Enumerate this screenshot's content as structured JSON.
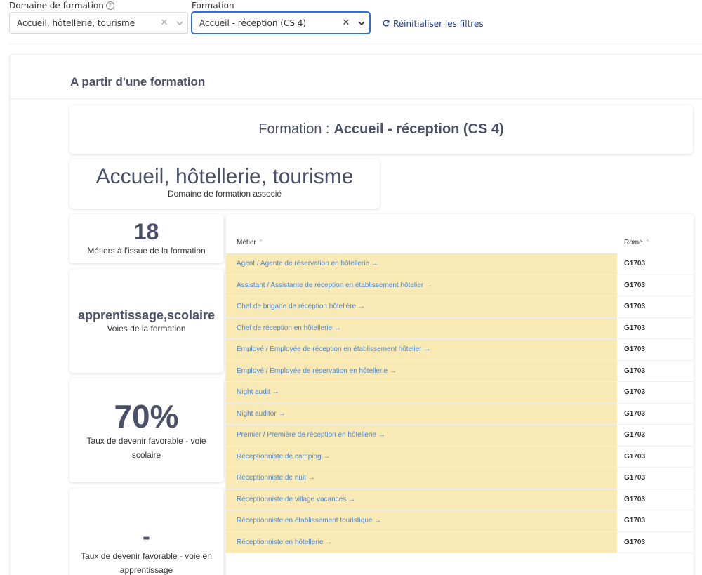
{
  "filters": {
    "domaine": {
      "label": "Domaine de formation",
      "value": "Accueil, hôtellerie, tourisme"
    },
    "formation": {
      "label": "Formation",
      "value": "Accueil - réception (CS 4)"
    },
    "reset_label": "Réinitialiser les filtres"
  },
  "section_title": "A partir d'une formation",
  "formation_card": {
    "prefix": "Formation :",
    "name": "Accueil - réception (CS 4)"
  },
  "domaine_card": {
    "title": "Accueil, hôtellerie, tourisme",
    "label": "Domaine de formation associé"
  },
  "stats": [
    {
      "value": "18",
      "label": "Métiers à l'issue de la formation"
    },
    {
      "value": "apprentissage,scolaire",
      "label": "Voies de la formation"
    },
    {
      "value": "70%",
      "label": "Taux de devenir favorable - voie scolaire"
    },
    {
      "value": "-",
      "label": "Taux de devenir favorable - voie en apprentissage"
    }
  ],
  "table": {
    "columns": [
      "Métier",
      "Rome"
    ],
    "rows": [
      {
        "metier": "Agent / Agente de réservation en hôtellerie →",
        "rome": "G1703"
      },
      {
        "metier": "Assistant / Assistante de réception en établissement hôtelier →",
        "rome": "G1703"
      },
      {
        "metier": "Chef de brigade de réception hôtelière →",
        "rome": "G1703"
      },
      {
        "metier": "Chef de réception en hôtellerie →",
        "rome": "G1703"
      },
      {
        "metier": "Employé / Employée de réception en établissement hôtelier →",
        "rome": "G1703"
      },
      {
        "metier": "Employé / Employée de réservation en hôtellerie →",
        "rome": "G1703"
      },
      {
        "metier": "Night audit →",
        "rome": "G1703"
      },
      {
        "metier": "Night auditor →",
        "rome": "G1703"
      },
      {
        "metier": "Premier / Première de réception en hôtellerie →",
        "rome": "G1703"
      },
      {
        "metier": "Réceptionniste de camping →",
        "rome": "G1703"
      },
      {
        "metier": "Réceptionniste de nuit →",
        "rome": "G1703"
      },
      {
        "metier": "Réceptionniste de village vacances →",
        "rome": "G1703"
      },
      {
        "metier": "Réceptionniste en établissement touristique →",
        "rome": "G1703"
      },
      {
        "metier": "Réceptionniste en hôtellerie →",
        "rome": "G1703"
      }
    ]
  },
  "colors": {
    "highlight": "#f9e9b5",
    "link": "#4a87d9",
    "accent": "#2d6fd6",
    "text": "#4a5068"
  }
}
